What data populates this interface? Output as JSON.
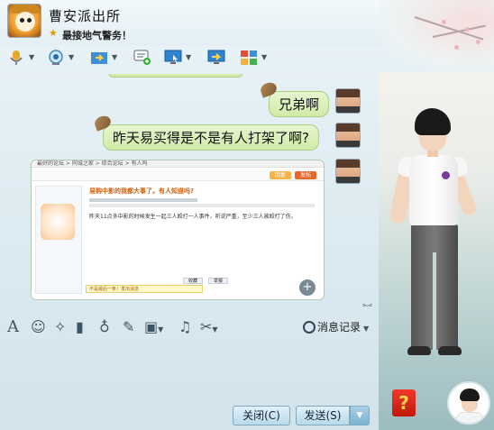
{
  "window": {
    "contact_name": "曹安派出所",
    "signature": "最接地气警务！",
    "controls": {
      "pin": "—",
      "minimize": "—",
      "maximize": "□",
      "close": "✕"
    }
  },
  "toolbar": {
    "items": [
      {
        "icon": "microphone-icon"
      },
      {
        "icon": "webcam-icon"
      },
      {
        "icon": "file-transfer-icon"
      },
      {
        "icon": "chat-create-group-icon"
      },
      {
        "icon": "remote-assist-icon"
      },
      {
        "icon": "share-screen-icon"
      },
      {
        "icon": "apps-grid-icon"
      }
    ]
  },
  "chat": {
    "truncated_top_message": "…",
    "messages": [
      {
        "text": "兄弟啊"
      },
      {
        "text": "昨天易买得是不是有人打架了啊?"
      }
    ],
    "screenshot": {
      "bar_text": "最好的论坛 > 同城之家 > 综合论坛 > 有人吗",
      "post_title": "易购中影的我都大事了。有人知道吗?",
      "post_text": "昨天11点多中影的时候发生一起三人殴打一人事件，听说严重，至少三人被殴打了伤。",
      "reply_label": "回复",
      "post_button": "发帖",
      "footer_text": "不是最后一条！发出消息",
      "label_new": "收藏",
      "label_jump": "举报"
    }
  },
  "input_toolbar": {
    "history_label": "消息记录"
  },
  "buttons": {
    "close_label": "关闭(C)",
    "send_label": "发送(S)"
  },
  "side": {
    "help_label": "?"
  }
}
